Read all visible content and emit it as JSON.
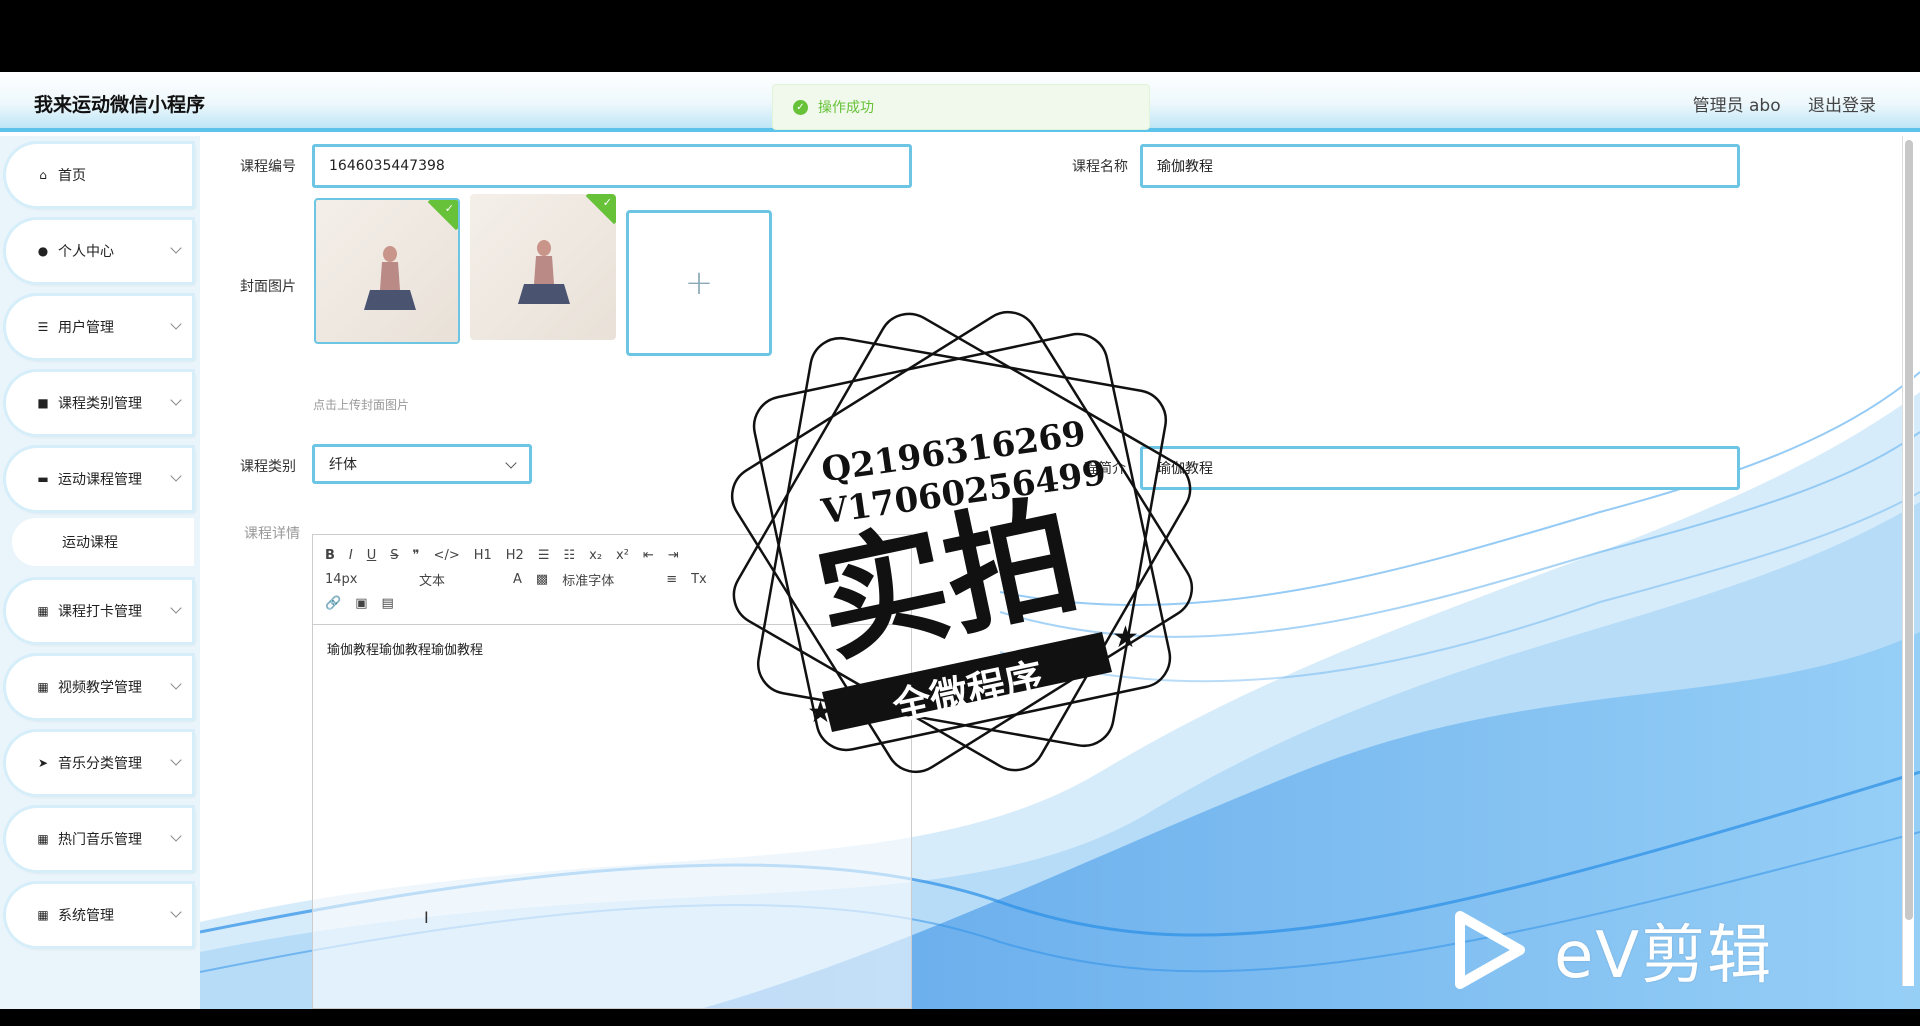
{
  "app": {
    "title": "我来运动微信小程序"
  },
  "header": {
    "admin_label": "管理员 abo",
    "logout_label": "退出登录"
  },
  "toast": {
    "message": "操作成功"
  },
  "sidebar": {
    "items": [
      {
        "label": "首页",
        "icon": "home-icon"
      },
      {
        "label": "个人中心",
        "icon": "user-icon"
      },
      {
        "label": "用户管理",
        "icon": "list-icon"
      },
      {
        "label": "课程类别管理",
        "icon": "camera-icon"
      },
      {
        "label": "运动课程管理",
        "icon": "monitor-icon"
      },
      {
        "label": "运动课程",
        "icon": ""
      },
      {
        "label": "课程打卡管理",
        "icon": "grid-icon"
      },
      {
        "label": "视频教学管理",
        "icon": "grid-icon"
      },
      {
        "label": "音乐分类管理",
        "icon": "send-icon"
      },
      {
        "label": "热门音乐管理",
        "icon": "grid-icon"
      },
      {
        "label": "系统管理",
        "icon": "grid-icon"
      }
    ]
  },
  "form": {
    "course_id_label": "课程编号",
    "course_id_value": "1646035447398",
    "course_name_label": "课程名称",
    "course_name_value": "瑜伽教程",
    "cover_label": "封面图片",
    "cover_hint": "点击上传封面图片",
    "category_label": "课程类别",
    "category_value": "纤体",
    "intro_label": "程简介",
    "intro_value": "瑜伽教程",
    "detail_label": "课程详情"
  },
  "editor": {
    "row1": [
      "B",
      "I",
      "U",
      "S",
      "❞",
      "</>",
      "H1",
      "H2",
      "☰",
      "☷",
      "x₂",
      "x²",
      "⇤",
      "⇥"
    ],
    "font_size": "14px",
    "text_style": "文本",
    "font_family": "标准字体",
    "content": "瑜伽教程瑜伽教程瑜伽教程"
  },
  "watermark": {
    "line1": "Q2196316269",
    "line2": "V17060256499",
    "big": "实拍",
    "banner": "全微程序"
  },
  "ev": {
    "text": "eV剪辑"
  },
  "colors": {
    "accent": "#6cc5e2",
    "success": "#67c23a",
    "wave": "#2a8ee6"
  }
}
